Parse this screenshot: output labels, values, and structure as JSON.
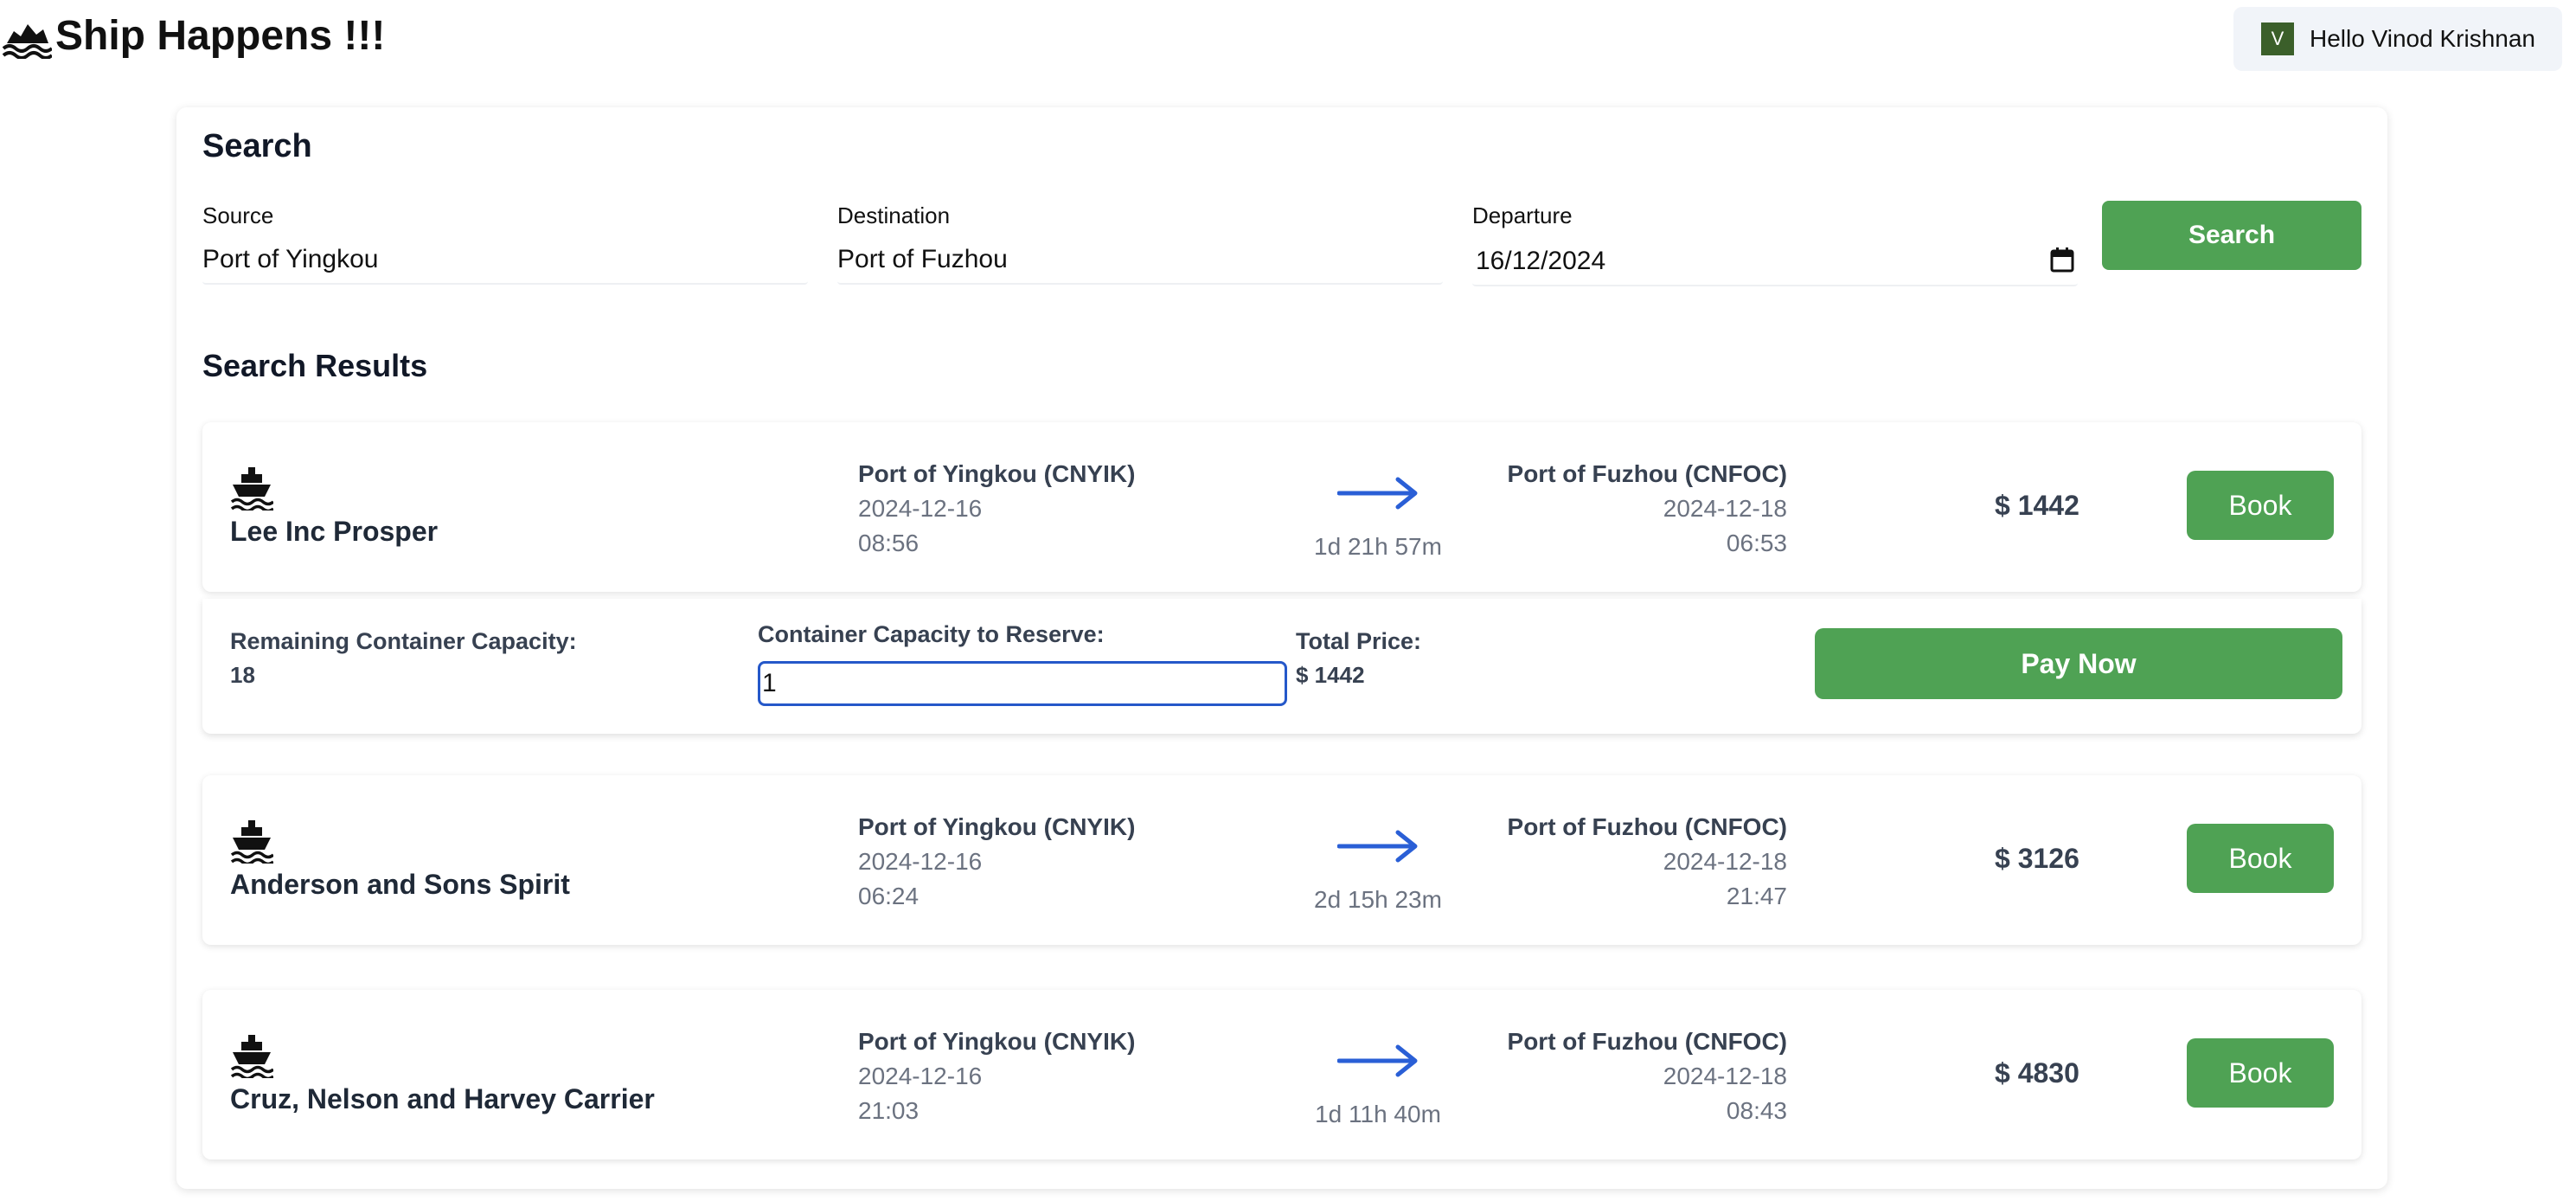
{
  "header": {
    "app_title": "Ship Happens !!!",
    "user": {
      "avatar_initial": "V",
      "greeting": "Hello Vinod Krishnan"
    }
  },
  "search": {
    "title": "Search",
    "source": {
      "label": "Source",
      "value": "Port of Yingkou"
    },
    "destination": {
      "label": "Destination",
      "value": "Port of Fuzhou"
    },
    "departure": {
      "label": "Departure",
      "value": "16/12/2024"
    },
    "button_label": "Search"
  },
  "results": {
    "title": "Search Results",
    "book_label": "Book",
    "items": [
      {
        "vessel": "Lee Inc Prosper",
        "origin_port": "Port of Yingkou (CNYIK)",
        "origin_date": "2024-12-16",
        "origin_time": "08:56",
        "duration": "1d 21h 57m",
        "dest_port": "Port of Fuzhou (CNFOC)",
        "dest_date": "2024-12-18",
        "dest_time": "06:53",
        "price": "$ 1442"
      },
      {
        "vessel": "Anderson and Sons Spirit",
        "origin_port": "Port of Yingkou (CNYIK)",
        "origin_date": "2024-12-16",
        "origin_time": "06:24",
        "duration": "2d 15h 23m",
        "dest_port": "Port of Fuzhou (CNFOC)",
        "dest_date": "2024-12-18",
        "dest_time": "21:47",
        "price": "$ 3126"
      },
      {
        "vessel": "Cruz, Nelson and Harvey Carrier",
        "origin_port": "Port of Yingkou (CNYIK)",
        "origin_date": "2024-12-16",
        "origin_time": "21:03",
        "duration": "1d 11h 40m",
        "dest_port": "Port of Fuzhou (CNFOC)",
        "dest_date": "2024-12-18",
        "dest_time": "08:43",
        "price": "$ 4830"
      }
    ]
  },
  "booking": {
    "remaining_label": "Remaining Container Capacity:",
    "remaining_value": "18",
    "reserve_label": "Container Capacity to Reserve:",
    "reserve_value": "1",
    "total_label": "Total Price:",
    "total_value": "$ 1442",
    "pay_label": "Pay Now"
  },
  "colors": {
    "primary_green": "#4fa254",
    "focus_blue": "#2558c9",
    "arrow_blue": "#2a5fd6",
    "avatar_bg": "#3b5f2a"
  },
  "icons": {
    "brand": "ship-wave-icon",
    "vessel": "ship-icon",
    "route": "arrow-right-icon",
    "date_picker": "calendar-icon"
  }
}
